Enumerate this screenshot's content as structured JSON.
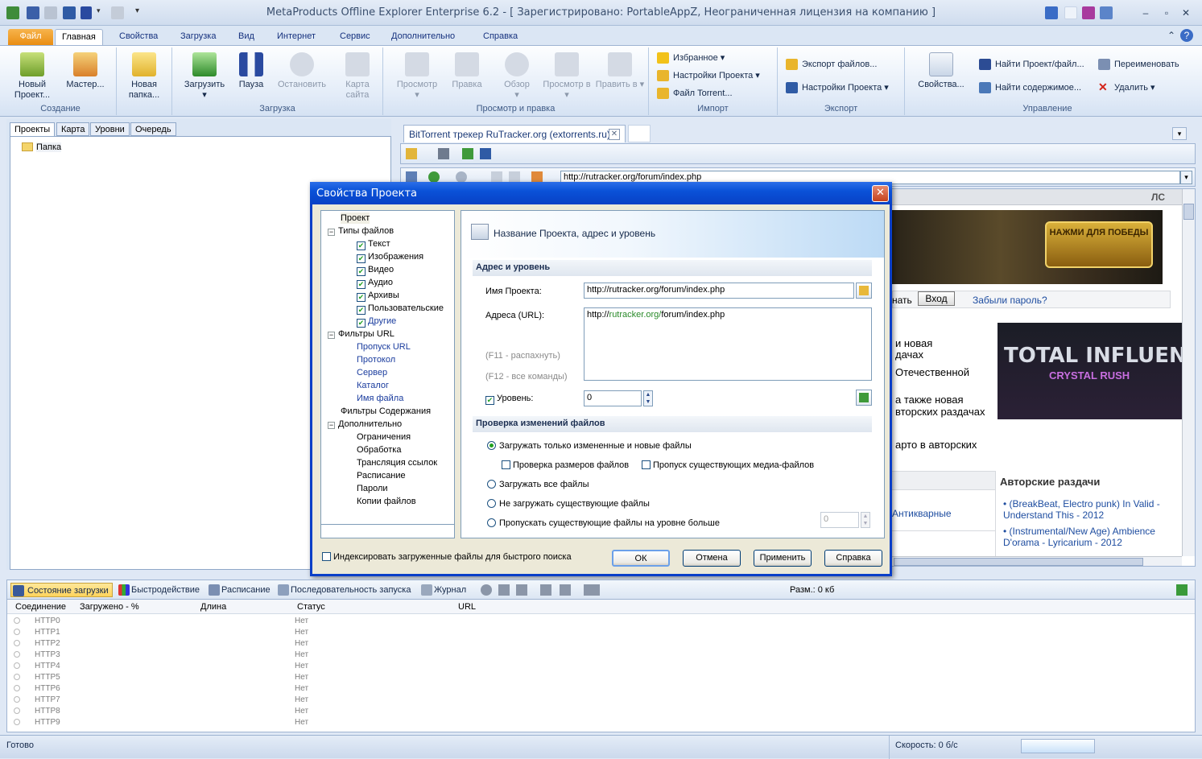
{
  "window": {
    "title": "MetaProducts Offline Explorer Enterprise 6.2 - [ Зарегистрировано: PortableAppZ, Неограниченная лицензия на компанию ]"
  },
  "ribbon_tabs": [
    "Файл",
    "Главная",
    "Свойства",
    "Загрузка",
    "Вид",
    "Интернет",
    "Сервис",
    "Дополнительно",
    "Справка"
  ],
  "ribbon": {
    "groups": {
      "create": "Создание",
      "download": "Загрузка",
      "view": "Просмотр и правка",
      "import": "Импорт",
      "export": "Экспорт",
      "manage": "Управление"
    },
    "new_project": "Новый Проект...",
    "wizard": "Мастер...",
    "new_folder": "Новая папка...",
    "download_btn": "Загрузить",
    "pause": "Пауза",
    "stop": "Остановить",
    "site_map": "Карта сайта",
    "preview": "Просмотр",
    "edit": "Правка",
    "overview": "Обзор",
    "view_in": "Просмотр в",
    "edit_in": "Править в",
    "favorites": "Избранное",
    "project_settings": "Настройки Проекта",
    "torrent_file": "Файл Torrent...",
    "export_files": "Экспорт файлов...",
    "export_settings": "Настройки Проекта",
    "properties": "Свойства...",
    "find_project": "Найти Проект/файл...",
    "find_content": "Найти содержимое...",
    "rename": "Переименовать",
    "delete": "Удалить"
  },
  "left_panel": {
    "tabs": [
      "Проекты",
      "Карта",
      "Уровни",
      "Очередь"
    ],
    "tree_item": "Папка"
  },
  "browser": {
    "tab_title": "BitTorrent трекер RuTracker.org (extorrents.ru)",
    "url": "http://rutracker.org/forum/index.php",
    "page": {
      "header_right": "ЛС",
      "banner_text": "НАЖМИ ДЛЯ ПОБЕДЫ",
      "login_label": "нать",
      "login_button": "Вход",
      "forgot": "Забыли пароль?",
      "news1": "и новая",
      "news2": "дачах",
      "news3": "Отечественной",
      "news4": "а также новая",
      "news5": "вторских раздачах",
      "news6": "арто в авторских",
      "ad_title": "TOTAL INFLUENCE",
      "ad_sub": "CRYSTAL RUSH",
      "antique": "Антикварные",
      "authors_title": "Авторские раздачи",
      "authors": [
        "(BreakBeat, Electro punk) In Valid - Understand This - 2012",
        "(Instrumental/New Age) Ambience D'orama - Lyricarium - 2012"
      ]
    }
  },
  "dialog": {
    "title": "Свойства Проекта",
    "tree": {
      "project": "Проект",
      "file_types": "Типы файлов",
      "text": "Текст",
      "images": "Изображения",
      "video": "Видео",
      "audio": "Аудио",
      "archives": "Архивы",
      "custom": "Пользовательские",
      "other": "Другие",
      "url_filters": "Фильтры URL",
      "url_skip": "Пропуск URL",
      "protocol": "Протокол",
      "server": "Сервер",
      "directory": "Каталог",
      "file_name": "Имя файла",
      "content_filters": "Фильтры Содержания",
      "advanced": "Дополнительно",
      "limits": "Ограничения",
      "processing": "Обработка",
      "link_translation": "Трансляция ссылок",
      "schedule": "Расписание",
      "passwords": "Пароли",
      "file_copies": "Копии файлов"
    },
    "header": "Название Проекта, адрес и уровень",
    "section1": "Адрес и уровень",
    "project_name_label": "Имя Проекта:",
    "project_name_value": "http://rutracker.org/forum/index.php",
    "urls_label": "Адреса (URL):",
    "url_prefix": "http://",
    "url_host": "rutracker.org/",
    "url_path": "forum/index.php",
    "hint_f11": "(F11 - распахнуть)",
    "hint_f12": "(F12 - все команды)",
    "level_label": "Уровень:",
    "level_value": "0",
    "section2": "Проверка изменений файлов",
    "opt_changed": "Загружать только измененные и новые файлы",
    "chk_sizes": "Проверка размеров файлов",
    "chk_media": "Пропуск существующих медиа-файлов",
    "opt_all": "Загружать все файлы",
    "opt_no_existing": "Не загружать существующие файлы",
    "opt_skip_level": "Пропускать существующие файлы на уровне больше",
    "skip_level_value": "0",
    "index_checkbox": "Индексировать загруженные файлы для быстрого поиска",
    "btn_ok": "ОК",
    "btn_cancel": "Отмена",
    "btn_apply": "Применить",
    "btn_help": "Справка"
  },
  "bottom_panel": {
    "tabs": [
      "Состояние загрузки",
      "Быстродействие",
      "Расписание",
      "Последовательность запуска",
      "Журнал"
    ],
    "size_label": "Разм.: 0 кб",
    "columns": [
      "Соединение",
      "Загружено - %",
      "Длина",
      "Статус",
      "URL"
    ],
    "rows": [
      {
        "conn": "HTTP0",
        "status": "Нет"
      },
      {
        "conn": "HTTP1",
        "status": "Нет"
      },
      {
        "conn": "HTTP2",
        "status": "Нет"
      },
      {
        "conn": "HTTP3",
        "status": "Нет"
      },
      {
        "conn": "HTTP4",
        "status": "Нет"
      },
      {
        "conn": "HTTP5",
        "status": "Нет"
      },
      {
        "conn": "HTTP6",
        "status": "Нет"
      },
      {
        "conn": "HTTP7",
        "status": "Нет"
      },
      {
        "conn": "HTTP8",
        "status": "Нет"
      },
      {
        "conn": "HTTP9",
        "status": "Нет"
      }
    ]
  },
  "status_bar": {
    "ready": "Готово",
    "speed": "Скорость: 0 б/с"
  }
}
